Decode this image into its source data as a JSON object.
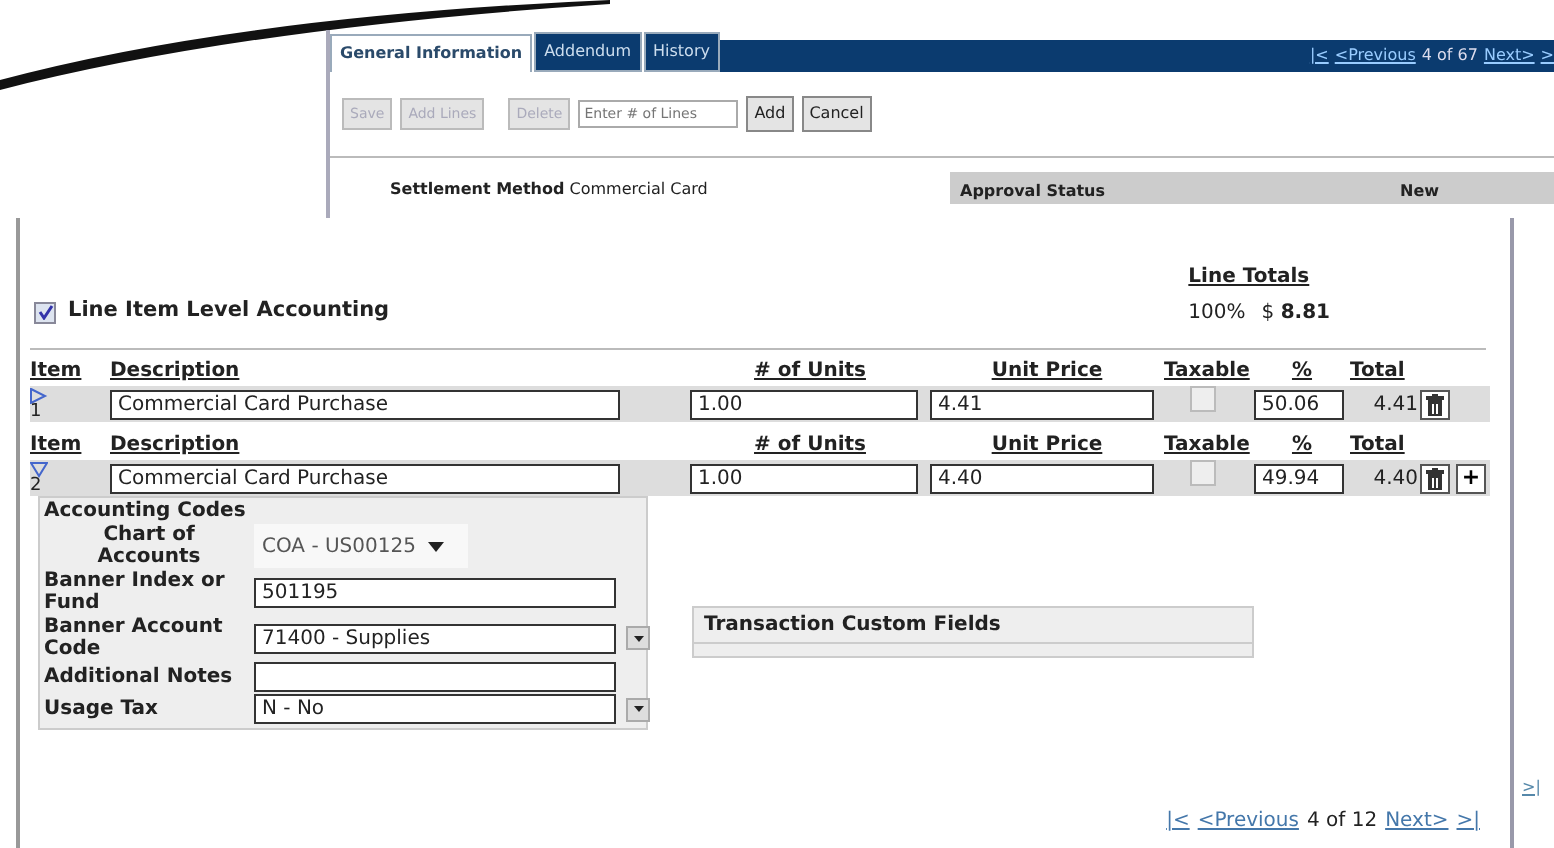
{
  "background_window": {
    "tabs": [
      {
        "label": "General Information",
        "selected": true
      },
      {
        "label": "Addendum",
        "selected": false
      },
      {
        "label": "History",
        "selected": false
      }
    ],
    "pager": {
      "first": "|<",
      "previous": "<Previous",
      "position": "4 of 67",
      "next": "Next>",
      "last": ">"
    },
    "toolbar": {
      "buttons": [
        {
          "label": "Save",
          "disabled": true
        },
        {
          "label": "Add Lines",
          "disabled": true
        },
        {
          "label": "Delete",
          "disabled": true
        }
      ],
      "lines_field": {
        "placeholder": "Enter # of Lines"
      },
      "actions": [
        "Add",
        "Cancel"
      ]
    },
    "details": [
      {
        "label": "Settlement Method",
        "value": "Commercial Card"
      }
    ],
    "approval_table": {
      "columns": [
        "Approval Status",
        "New"
      ]
    },
    "side_pager_fragment": ">|"
  },
  "line_item_panel": {
    "line_item_level_accounting": {
      "label": "Line Item Level Accounting",
      "checked": true
    },
    "line_totals": {
      "title": "Line Totals",
      "percent": "100%",
      "currency": "$",
      "amount": "8.81"
    },
    "items": [
      {
        "headers": [
          "Item",
          "Description",
          "# of Units",
          "Unit Price",
          "Taxable",
          "%",
          "Total"
        ],
        "number": "1",
        "expanded": false,
        "description": "Commercial Card Purchase",
        "units": "1.00",
        "unit_price": "4.41",
        "taxable": false,
        "percent": "50.06",
        "total": "4.41"
      },
      {
        "headers": [
          "Item",
          "Description",
          "# of Units",
          "Unit Price",
          "Taxable",
          "%",
          "Total"
        ],
        "number": "2",
        "expanded": true,
        "description": "Commercial Card Purchase",
        "units": "1.00",
        "unit_price": "4.40",
        "taxable": false,
        "percent": "49.94",
        "total": "4.40",
        "add_button": "+"
      }
    ],
    "accounting_codes": {
      "title": "Accounting Codes",
      "fields": [
        {
          "label": "Chart of Accounts",
          "kind": "select",
          "value": "COA - US00125"
        },
        {
          "label": "Banner Index or Fund",
          "kind": "text",
          "value": "501195"
        },
        {
          "label": "Banner Account Code",
          "kind": "combo",
          "value": "71400 - Supplies"
        },
        {
          "label": "Additional Notes",
          "kind": "text"
        },
        {
          "label": "Usage Tax",
          "kind": "combo",
          "value": "N - No"
        }
      ]
    },
    "custom_fields": {
      "title": "Transaction Custom Fields"
    },
    "pager": {
      "first": "|<",
      "previous": "<Previous",
      "position": "4 of 12",
      "next": "Next>",
      "last": ">|"
    }
  }
}
